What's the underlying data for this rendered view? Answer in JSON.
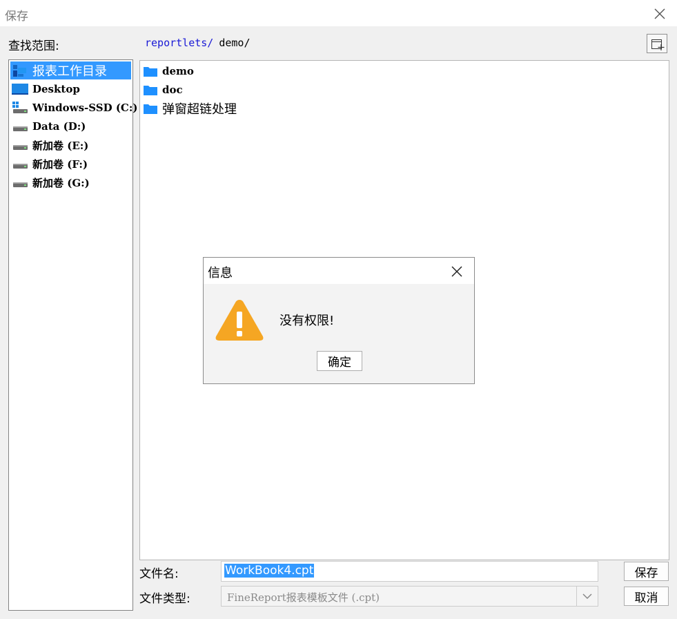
{
  "window": {
    "title": "保存"
  },
  "toolbar": {
    "look_in_label": "查找范围:",
    "path_segments": [
      "reportlets/",
      "demo/"
    ],
    "new_folder_icon": "new-folder-icon"
  },
  "places": [
    {
      "label": "报表工作目录",
      "icon": "report-dir-icon",
      "selected": true
    },
    {
      "label": "Desktop",
      "icon": "desktop-icon",
      "selected": false
    },
    {
      "label": "Windows-SSD (C:)",
      "icon": "windows-drive-icon",
      "selected": false
    },
    {
      "label": "Data (D:)",
      "icon": "drive-icon",
      "selected": false
    },
    {
      "label": "新加卷 (E:)",
      "icon": "drive-icon",
      "selected": false
    },
    {
      "label": "新加卷 (F:)",
      "icon": "drive-icon",
      "selected": false
    },
    {
      "label": "新加卷 (G:)",
      "icon": "drive-icon",
      "selected": false
    }
  ],
  "files": [
    {
      "label": "demo",
      "icon": "folder-icon"
    },
    {
      "label": "doc",
      "icon": "folder-icon"
    },
    {
      "label": "弹窗超链处理",
      "icon": "folder-icon"
    }
  ],
  "form": {
    "filename_label": "文件名:",
    "filename_value": "WorkBook4.cpt",
    "filetype_label": "文件类型:",
    "filetype_value": "FineReport报表模板文件 (.cpt)",
    "save_button": "保存",
    "cancel_button": "取消"
  },
  "dialog": {
    "title": "信息",
    "message": "没有权限!",
    "ok_button": "确定",
    "icon": "warning-icon"
  },
  "colors": {
    "selection": "#3399ff",
    "path_link": "#1a1ad6",
    "folder": "#1e90ff",
    "warning": "#f5a623"
  }
}
